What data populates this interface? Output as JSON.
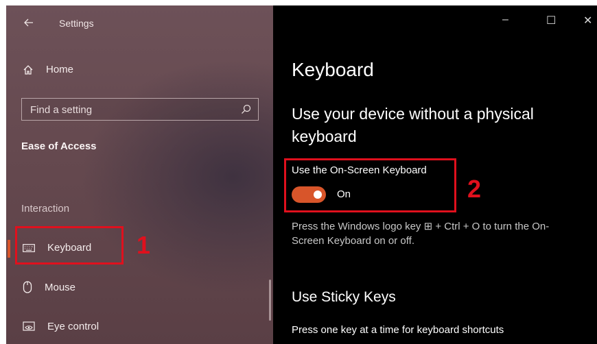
{
  "window": {
    "title": "Settings",
    "controls": {
      "minimize": "–",
      "maximize": "☐",
      "close": "✕"
    }
  },
  "sidebar": {
    "home_label": "Home",
    "search_placeholder": "Find a setting",
    "section_title": "Ease of Access",
    "group_heading": "Interaction",
    "items": [
      {
        "label": "Keyboard",
        "icon": "keyboard-icon",
        "selected": true
      },
      {
        "label": "Mouse",
        "icon": "mouse-icon",
        "selected": false
      },
      {
        "label": "Eye control",
        "icon": "eye-control-icon",
        "selected": false
      }
    ]
  },
  "main": {
    "page_title": "Keyboard",
    "section1_heading": "Use your device without a physical keyboard",
    "osk_label": "Use the On-Screen Keyboard",
    "osk_toggle_state": "On",
    "osk_desc": "Press the Windows logo key ⊞ + Ctrl + O to turn the On-Screen Keyboard on or off.",
    "section2_heading": "Use Sticky Keys",
    "sticky_desc": "Press one key at a time for keyboard shortcuts"
  },
  "annotations": {
    "marker1": "1",
    "marker2": "2"
  },
  "colors": {
    "accent": "#d8552a",
    "highlight_box": "#e0101d",
    "sidebar_bg": "#65494f",
    "main_bg": "#000000"
  }
}
